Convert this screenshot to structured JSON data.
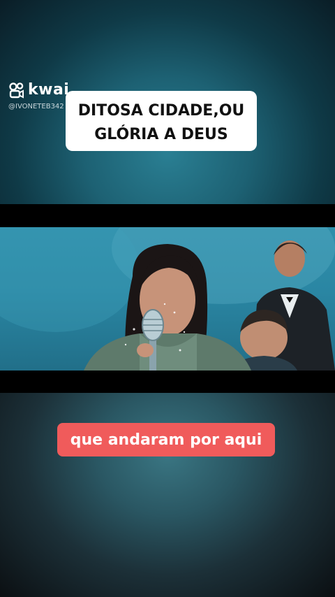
{
  "app": {
    "brand": "kwai",
    "username": "@IVONETEB342"
  },
  "overlay": {
    "title_lines": [
      "DITOSA CIDADE,OU",
      "GLÓRIA A DEUS"
    ],
    "caption": "que andaram por aqui"
  },
  "video": {
    "watermark": ""
  },
  "colors": {
    "title_bg": "#ffffff",
    "caption_bg": "#f05b5b",
    "stage_blue": "#2a86a3"
  },
  "icons": {
    "brand_icon": "kwai-logo-icon"
  }
}
